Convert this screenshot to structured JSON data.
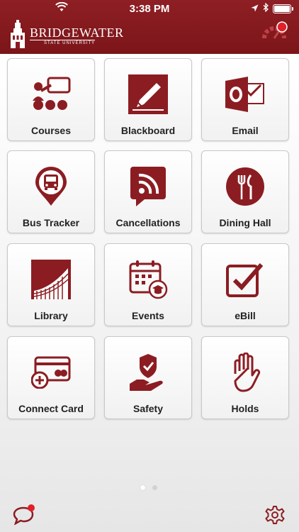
{
  "status_bar": {
    "time": "3:38 PM"
  },
  "header": {
    "logo_word": "BRIDGEWATER",
    "logo_sub": "STATE UNIVERSITY",
    "accent": "#8b1d22"
  },
  "tiles": [
    {
      "label": "Courses",
      "icon": "courses-icon"
    },
    {
      "label": "Blackboard",
      "icon": "blackboard-icon"
    },
    {
      "label": "Email",
      "icon": "email-icon"
    },
    {
      "label": "Bus Tracker",
      "icon": "bus-tracker-icon"
    },
    {
      "label": "Cancellations",
      "icon": "cancellations-icon"
    },
    {
      "label": "Dining Hall",
      "icon": "dining-hall-icon"
    },
    {
      "label": "Library",
      "icon": "library-icon"
    },
    {
      "label": "Events",
      "icon": "events-icon"
    },
    {
      "label": "eBill",
      "icon": "ebill-icon"
    },
    {
      "label": "Connect Card",
      "icon": "connect-card-icon"
    },
    {
      "label": "Safety",
      "icon": "safety-icon"
    },
    {
      "label": "Holds",
      "icon": "holds-icon"
    }
  ],
  "pager": {
    "pages": 2,
    "current": 1
  },
  "footer": {
    "chat_icon": "chat-icon",
    "settings_icon": "gear-icon",
    "notification_color": "#e0202a"
  }
}
